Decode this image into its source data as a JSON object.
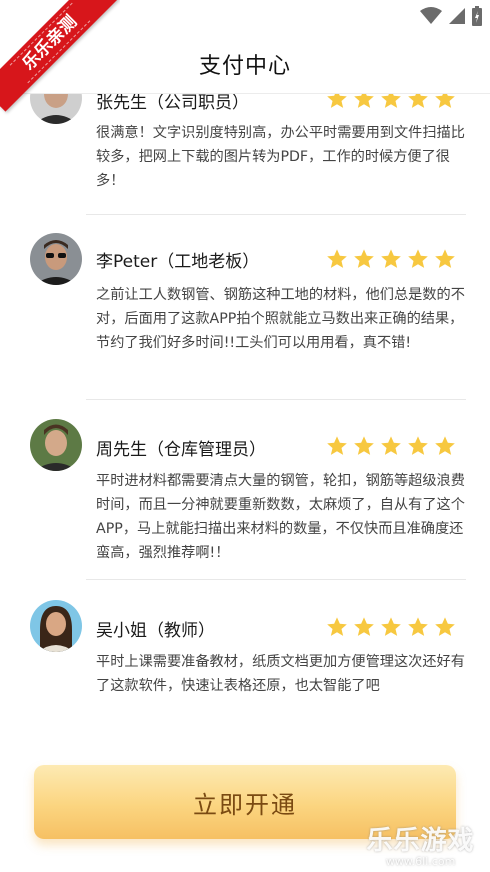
{
  "header": {
    "title": "支付中心"
  },
  "badge": {
    "text": "乐乐亲测"
  },
  "reviews": [
    {
      "name": "张先生（公司职员）",
      "comment": "很满意！文字识别度特别高，办公平时需要用到文件扫描比较多，把网上下载的图片转为PDF，工作的时候方便了很多！",
      "rating": 5
    },
    {
      "name": "李Peter（工地老板）",
      "comment": "之前让工人数钢管、钢筋这种工地的材料，他们总是数的不对，后面用了这款APP拍个照就能立马数出来正确的结果，节约了我们好多时间!!工头们可以用用看，真不错!",
      "rating": 5
    },
    {
      "name": "周先生（仓库管理员）",
      "comment": "平时进材料都需要清点大量的钢管，轮扣，钢筋等超级浪费时间，而且一分神就要重新数数，太麻烦了，自从有了这个APP，马上就能扫描出来材料的数量，不仅快而且准确度还蛮高，强烈推荐啊!！",
      "rating": 5
    },
    {
      "name": "吴小姐（教师）",
      "comment": "平时上课需要准备教材，纸质文档更加方便管理这次还好有了这款软件，快速让表格还原，也太智能了吧",
      "rating": 5
    }
  ],
  "cta": {
    "label": "立即开通"
  },
  "watermark": {
    "title": "乐乐游戏",
    "url": "www.6ll.com"
  },
  "colors": {
    "star": "#f7c840",
    "cta_text": "#7a4a12",
    "badge": "#d7161b"
  },
  "icons": [
    "wifi-icon",
    "signal-icon",
    "battery-icon",
    "back-arrow-icon",
    "star-icon"
  ]
}
